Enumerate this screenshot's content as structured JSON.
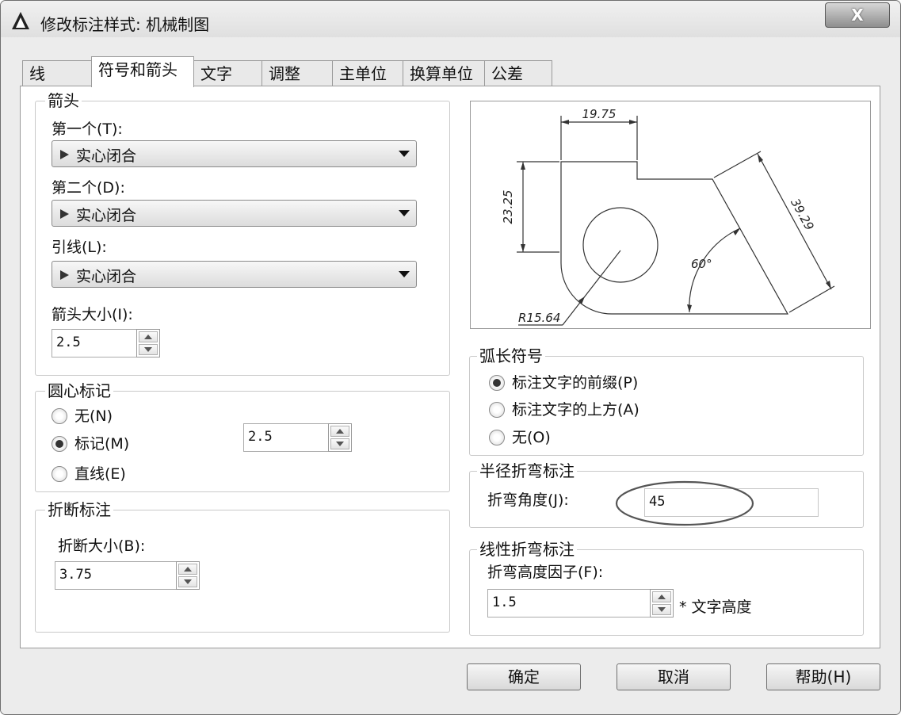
{
  "window": {
    "title": "修改标注样式: 机械制图",
    "close_label": "X"
  },
  "tabs": [
    {
      "label": "线"
    },
    {
      "label": "符号和箭头"
    },
    {
      "label": "文字"
    },
    {
      "label": "调整"
    },
    {
      "label": "主单位"
    },
    {
      "label": "换算单位"
    },
    {
      "label": "公差"
    }
  ],
  "arrows": {
    "legend": "箭头",
    "first_label": "第一个(T):",
    "first_value": "实心闭合",
    "second_label": "第二个(D):",
    "second_value": "实心闭合",
    "leader_label": "引线(L):",
    "leader_value": "实心闭合",
    "size_label": "箭头大小(I):",
    "size_value": "2.5"
  },
  "center_marks": {
    "legend": "圆心标记",
    "none_label": "无(N)",
    "mark_label": "标记(M)",
    "line_label": "直线(E)",
    "selected": "mark",
    "size_value": "2.5"
  },
  "break": {
    "legend": "折断标注",
    "size_label": "折断大小(B):",
    "size_value": "3.75"
  },
  "preview": {
    "dim_top": "19.75",
    "dim_left": "23.25",
    "dim_slant": "39.29",
    "angle": "60°",
    "radius": "R15.64"
  },
  "arc_length": {
    "legend": "弧长符号",
    "prefix_label": "标注文字的前缀(P)",
    "above_label": "标注文字的上方(A)",
    "none_label": "无(O)",
    "selected": "prefix"
  },
  "radius_jog": {
    "legend": "半径折弯标注",
    "angle_label": "折弯角度(J):",
    "angle_value": "45"
  },
  "linear_jog": {
    "legend": "线性折弯标注",
    "factor_label": "折弯高度因子(F):",
    "factor_value": "1.5",
    "suffix": "* 文字高度"
  },
  "buttons": {
    "ok": "确定",
    "cancel": "取消",
    "help": "帮助(H)"
  }
}
